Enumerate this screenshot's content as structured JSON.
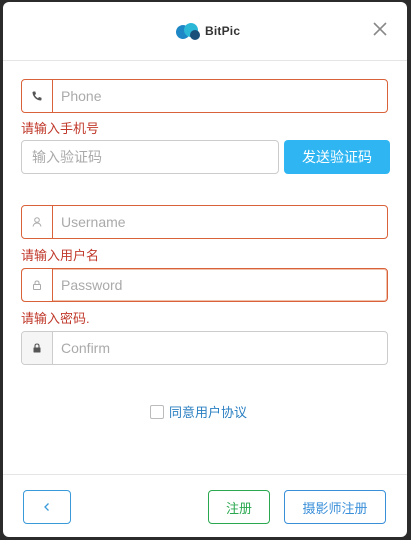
{
  "header": {
    "logo_text": "BitPic"
  },
  "form": {
    "phone": {
      "placeholder": "Phone",
      "value": "",
      "error": "请输入手机号"
    },
    "code": {
      "placeholder": "输入验证码",
      "value": "",
      "send_label": "发送验证码"
    },
    "username": {
      "placeholder": "Username",
      "value": "",
      "error": "请输入用户名"
    },
    "password": {
      "placeholder": "Password",
      "value": "",
      "error": "请输入密码."
    },
    "confirm": {
      "placeholder": "Confirm",
      "value": ""
    },
    "agree_label": "同意用户协议",
    "agree_checked": false
  },
  "footer": {
    "register_label": "注册",
    "photographer_register_label": "摄影师注册"
  },
  "colors": {
    "error": "#d9623a",
    "primary": "#2fb6f2",
    "success": "#2aa84f",
    "link": "#2a7fc1"
  }
}
